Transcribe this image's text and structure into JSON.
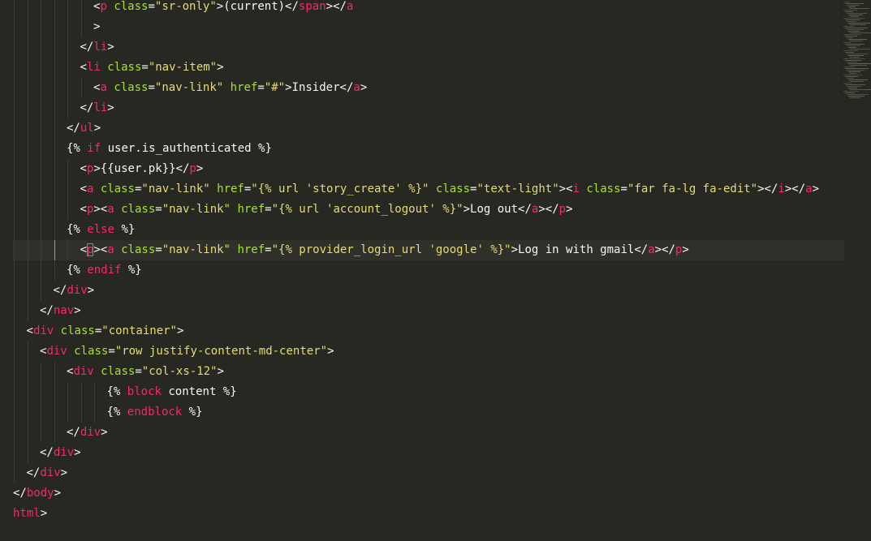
{
  "colors": {
    "background": "#272822",
    "text": "#f8f8f2",
    "tag": "#f92672",
    "attribute": "#a6e22e",
    "string": "#e6db74",
    "keyword": "#f92672",
    "active_line": "#2f302a",
    "indent_guide": "#3b3c35",
    "active_guide": "#d4942f"
  },
  "editor": {
    "lines": [
      {
        "indent": 7,
        "tokens": [
          [
            "t",
            "<"
          ],
          [
            "g",
            "p"
          ],
          [
            "t",
            " "
          ],
          [
            "a",
            "class"
          ],
          [
            "t",
            "="
          ],
          [
            "s",
            "\"sr-only\""
          ],
          [
            "t",
            ">(current)</"
          ],
          [
            "g",
            "span"
          ],
          [
            "t",
            "></"
          ],
          [
            "g",
            "a"
          ]
        ]
      },
      {
        "indent": 7,
        "tokens": [
          [
            "t",
            ">"
          ]
        ]
      },
      {
        "indent": 6,
        "tokens": [
          [
            "t",
            "</"
          ],
          [
            "g",
            "li"
          ],
          [
            "t",
            ">"
          ]
        ]
      },
      {
        "indent": 6,
        "tokens": [
          [
            "t",
            "<"
          ],
          [
            "g",
            "li"
          ],
          [
            "t",
            " "
          ],
          [
            "a",
            "class"
          ],
          [
            "t",
            "="
          ],
          [
            "s",
            "\"nav-item\""
          ],
          [
            "t",
            ">"
          ]
        ]
      },
      {
        "indent": 7,
        "tokens": [
          [
            "t",
            "<"
          ],
          [
            "g",
            "a"
          ],
          [
            "t",
            " "
          ],
          [
            "a",
            "class"
          ],
          [
            "t",
            "="
          ],
          [
            "s",
            "\"nav-link\""
          ],
          [
            "t",
            " "
          ],
          [
            "a",
            "href"
          ],
          [
            "t",
            "="
          ],
          [
            "s",
            "\"#\""
          ],
          [
            "t",
            ">Insider</"
          ],
          [
            "g",
            "a"
          ],
          [
            "t",
            ">"
          ]
        ]
      },
      {
        "indent": 6,
        "tokens": [
          [
            "t",
            "</"
          ],
          [
            "g",
            "li"
          ],
          [
            "t",
            ">"
          ]
        ]
      },
      {
        "indent": 5,
        "tokens": [
          [
            "t",
            "</"
          ],
          [
            "g",
            "ul"
          ],
          [
            "t",
            ">"
          ]
        ]
      },
      {
        "indent": 5,
        "tokens": [
          [
            "t",
            "{% "
          ],
          [
            "k",
            "if"
          ],
          [
            "t",
            " user.is_authenticated %}"
          ]
        ]
      },
      {
        "indent": 6,
        "tokens": [
          [
            "t",
            "<"
          ],
          [
            "g",
            "p"
          ],
          [
            "t",
            ">{{user.pk}}</"
          ],
          [
            "g",
            "p"
          ],
          [
            "t",
            ">"
          ]
        ]
      },
      {
        "indent": 6,
        "tokens": [
          [
            "t",
            "<"
          ],
          [
            "g",
            "a"
          ],
          [
            "t",
            " "
          ],
          [
            "a",
            "class"
          ],
          [
            "t",
            "="
          ],
          [
            "s",
            "\"nav-link\""
          ],
          [
            "t",
            " "
          ],
          [
            "a",
            "href"
          ],
          [
            "t",
            "="
          ],
          [
            "s",
            "\"{% url 'story_create' %}\""
          ],
          [
            "t",
            " "
          ],
          [
            "a",
            "class"
          ],
          [
            "t",
            "="
          ],
          [
            "s",
            "\"text-light\""
          ],
          [
            "t",
            "><"
          ],
          [
            "g",
            "i"
          ],
          [
            "t",
            " "
          ],
          [
            "a",
            "class"
          ],
          [
            "t",
            "="
          ],
          [
            "s",
            "\"far fa-lg fa-edit\""
          ],
          [
            "t",
            "></"
          ],
          [
            "g",
            "i"
          ],
          [
            "t",
            "></"
          ],
          [
            "g",
            "a"
          ],
          [
            "t",
            ">"
          ]
        ]
      },
      {
        "indent": 6,
        "tokens": [
          [
            "t",
            "<"
          ],
          [
            "g",
            "p"
          ],
          [
            "t",
            "><"
          ],
          [
            "g",
            "a"
          ],
          [
            "t",
            " "
          ],
          [
            "a",
            "class"
          ],
          [
            "t",
            "="
          ],
          [
            "s",
            "\"nav-link\""
          ],
          [
            "t",
            " "
          ],
          [
            "a",
            "href"
          ],
          [
            "t",
            "="
          ],
          [
            "s",
            "\"{% url 'account_logout' %}\""
          ],
          [
            "t",
            ">Log out</"
          ],
          [
            "g",
            "a"
          ],
          [
            "t",
            "></"
          ],
          [
            "g",
            "p"
          ],
          [
            "t",
            ">"
          ]
        ]
      },
      {
        "indent": 5,
        "tokens": [
          [
            "t",
            "{% "
          ],
          [
            "k",
            "else"
          ],
          [
            "t",
            " %}"
          ]
        ]
      },
      {
        "indent": 6,
        "active": true,
        "tokens": [
          [
            "t",
            "<"
          ],
          [
            "m",
            "p"
          ],
          [
            "t",
            "><"
          ],
          [
            "g",
            "a"
          ],
          [
            "t",
            " "
          ],
          [
            "a",
            "class"
          ],
          [
            "t",
            "="
          ],
          [
            "s",
            "\"nav-link\""
          ],
          [
            "t",
            " "
          ],
          [
            "a",
            "href"
          ],
          [
            "t",
            "="
          ],
          [
            "s",
            "\"{% provider_login_url 'google' %}\""
          ],
          [
            "t",
            ">Log in with gmail</"
          ],
          [
            "g",
            "a"
          ],
          [
            "t",
            "></"
          ],
          [
            "g",
            "p"
          ],
          [
            "t",
            ">"
          ]
        ]
      },
      {
        "indent": 5,
        "tokens": [
          [
            "t",
            "{% "
          ],
          [
            "k",
            "endif"
          ],
          [
            "t",
            " %}"
          ]
        ]
      },
      {
        "indent": 4,
        "tokens": [
          [
            "t",
            "</"
          ],
          [
            "g",
            "div"
          ],
          [
            "t",
            ">"
          ]
        ]
      },
      {
        "indent": 3,
        "tokens": [
          [
            "t",
            "</"
          ],
          [
            "g",
            "nav"
          ],
          [
            "t",
            ">"
          ]
        ]
      },
      {
        "indent": 2,
        "tokens": [
          [
            "t",
            "<"
          ],
          [
            "g",
            "div"
          ],
          [
            "t",
            " "
          ],
          [
            "a",
            "class"
          ],
          [
            "t",
            "="
          ],
          [
            "s",
            "\"container\""
          ],
          [
            "t",
            ">"
          ]
        ]
      },
      {
        "indent": 3,
        "tokens": [
          [
            "t",
            "<"
          ],
          [
            "g",
            "div"
          ],
          [
            "t",
            " "
          ],
          [
            "a",
            "class"
          ],
          [
            "t",
            "="
          ],
          [
            "s",
            "\"row justify-content-md-center\""
          ],
          [
            "t",
            ">"
          ]
        ]
      },
      {
        "indent": 5,
        "tokens": [
          [
            "t",
            "<"
          ],
          [
            "g",
            "div"
          ],
          [
            "t",
            " "
          ],
          [
            "a",
            "class"
          ],
          [
            "t",
            "="
          ],
          [
            "s",
            "\"col-xs-12\""
          ],
          [
            "t",
            ">"
          ]
        ]
      },
      {
        "indent": 8,
        "tokens": [
          [
            "t",
            "{% "
          ],
          [
            "k",
            "block"
          ],
          [
            "t",
            " content %}"
          ]
        ]
      },
      {
        "indent": 8,
        "tokens": [
          [
            "t",
            "{% "
          ],
          [
            "k",
            "endblock"
          ],
          [
            "t",
            " %}"
          ]
        ]
      },
      {
        "indent": 5,
        "tokens": [
          [
            "t",
            "</"
          ],
          [
            "g",
            "div"
          ],
          [
            "t",
            ">"
          ]
        ]
      },
      {
        "indent": 3,
        "tokens": [
          [
            "t",
            "</"
          ],
          [
            "g",
            "div"
          ],
          [
            "t",
            ">"
          ]
        ]
      },
      {
        "indent": 2,
        "tokens": [
          [
            "t",
            "</"
          ],
          [
            "g",
            "div"
          ],
          [
            "t",
            ">"
          ]
        ]
      },
      {
        "indent": 1,
        "tokens": [
          [
            "t",
            "</"
          ],
          [
            "g",
            "body"
          ],
          [
            "t",
            ">"
          ]
        ]
      },
      {
        "indent": 1,
        "tokens": [
          [
            "g",
            "html"
          ],
          [
            "t",
            ">"
          ]
        ]
      }
    ]
  }
}
